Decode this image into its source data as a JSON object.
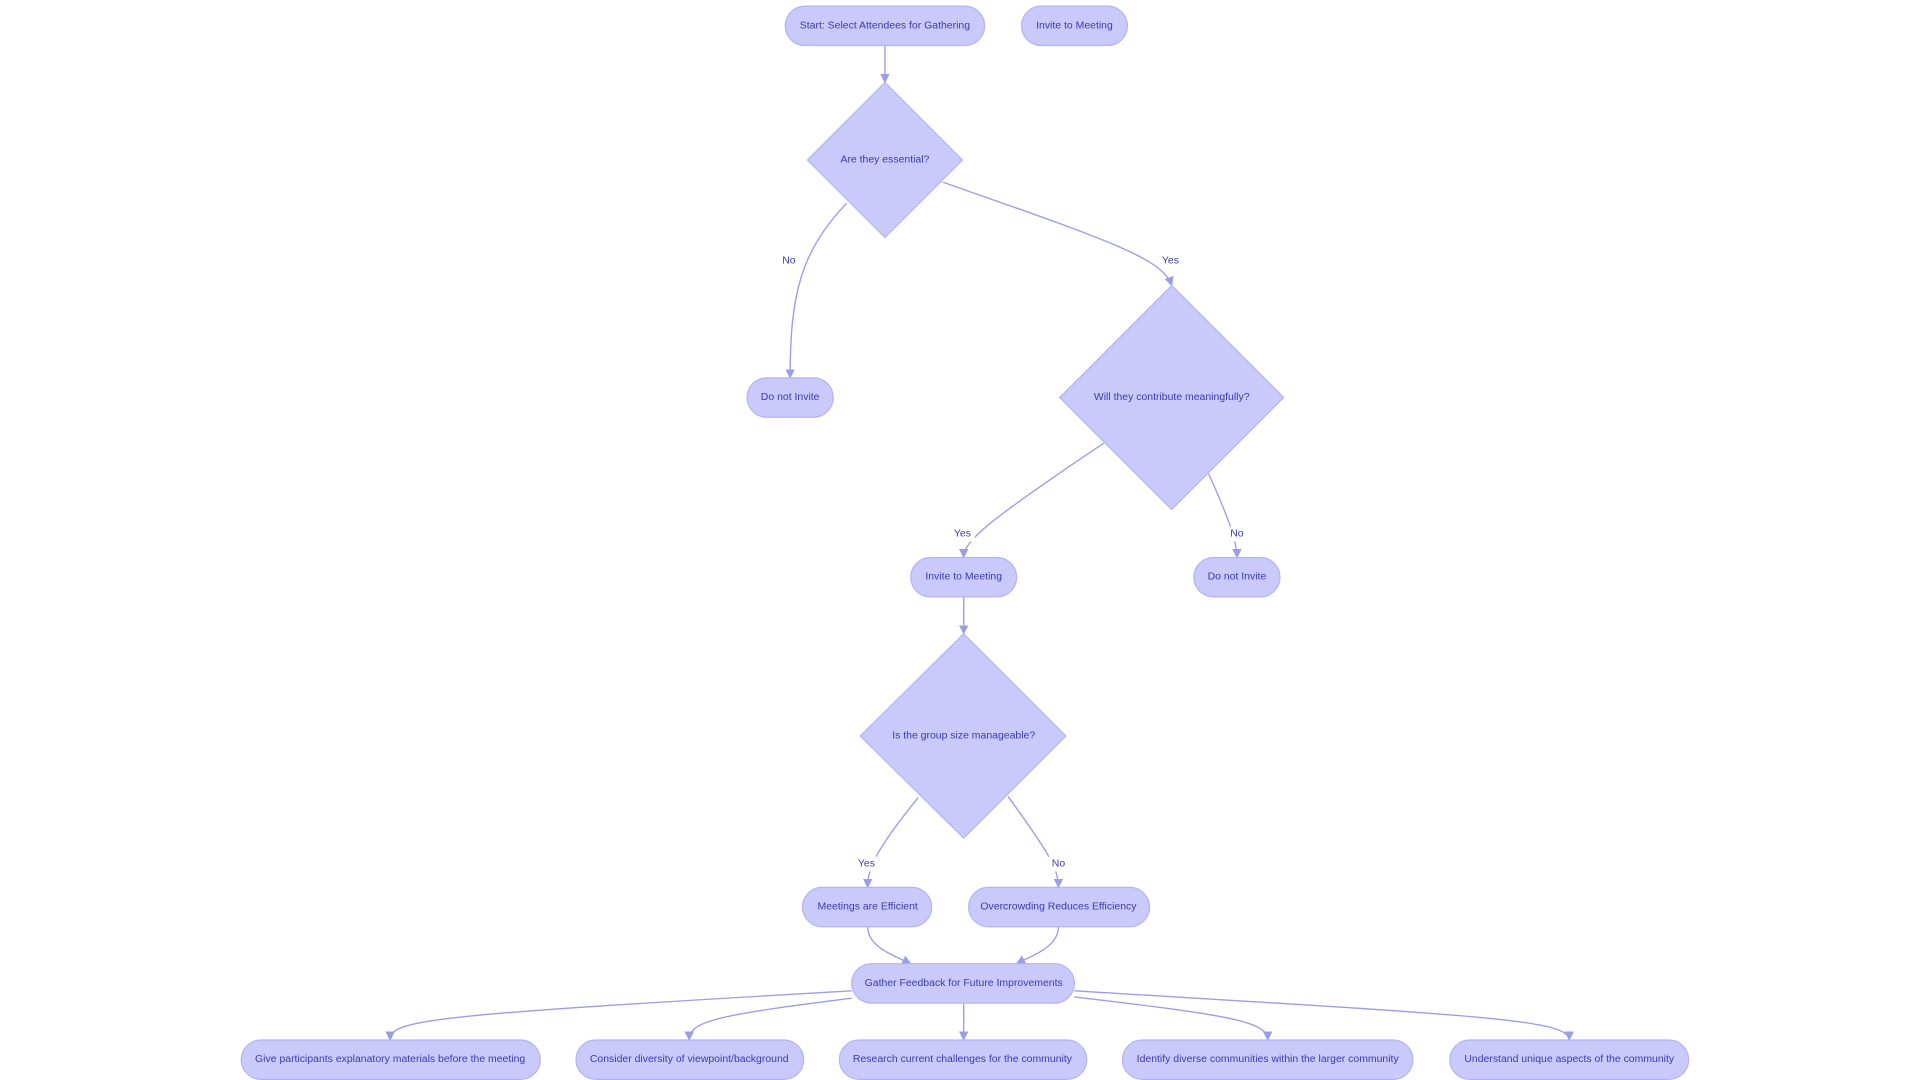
{
  "colors": {
    "node_fill": "#c9c9fb",
    "node_stroke": "#b4b4f2",
    "edge": "#9c9ce8",
    "text": "#3a3ab0"
  },
  "nodes": {
    "start": "Start: Select Attendees for Gathering",
    "invite_top": "Invite to Meeting",
    "essential": "Are they essential?",
    "do_not_invite_1": "Do not Invite",
    "contribute": "Will they contribute meaningfully?",
    "invite": "Invite to Meeting",
    "do_not_invite_2": "Do not Invite",
    "group_size": "Is the group size manageable?",
    "efficient": "Meetings are Efficient",
    "overcrowding": "Overcrowding Reduces Efficiency",
    "feedback": "Gather Feedback for Future Improvements",
    "outcomes": [
      "Give participants explanatory materials before the meeting",
      "Consider diversity of viewpoint/background",
      "Research current challenges for the community",
      "Identify diverse communities within the larger community",
      "Understand unique aspects of the community"
    ]
  },
  "edge_labels": {
    "essential_no": "No",
    "essential_yes": "Yes",
    "contribute_yes": "Yes",
    "contribute_no": "No",
    "size_yes": "Yes",
    "size_no": "No"
  }
}
